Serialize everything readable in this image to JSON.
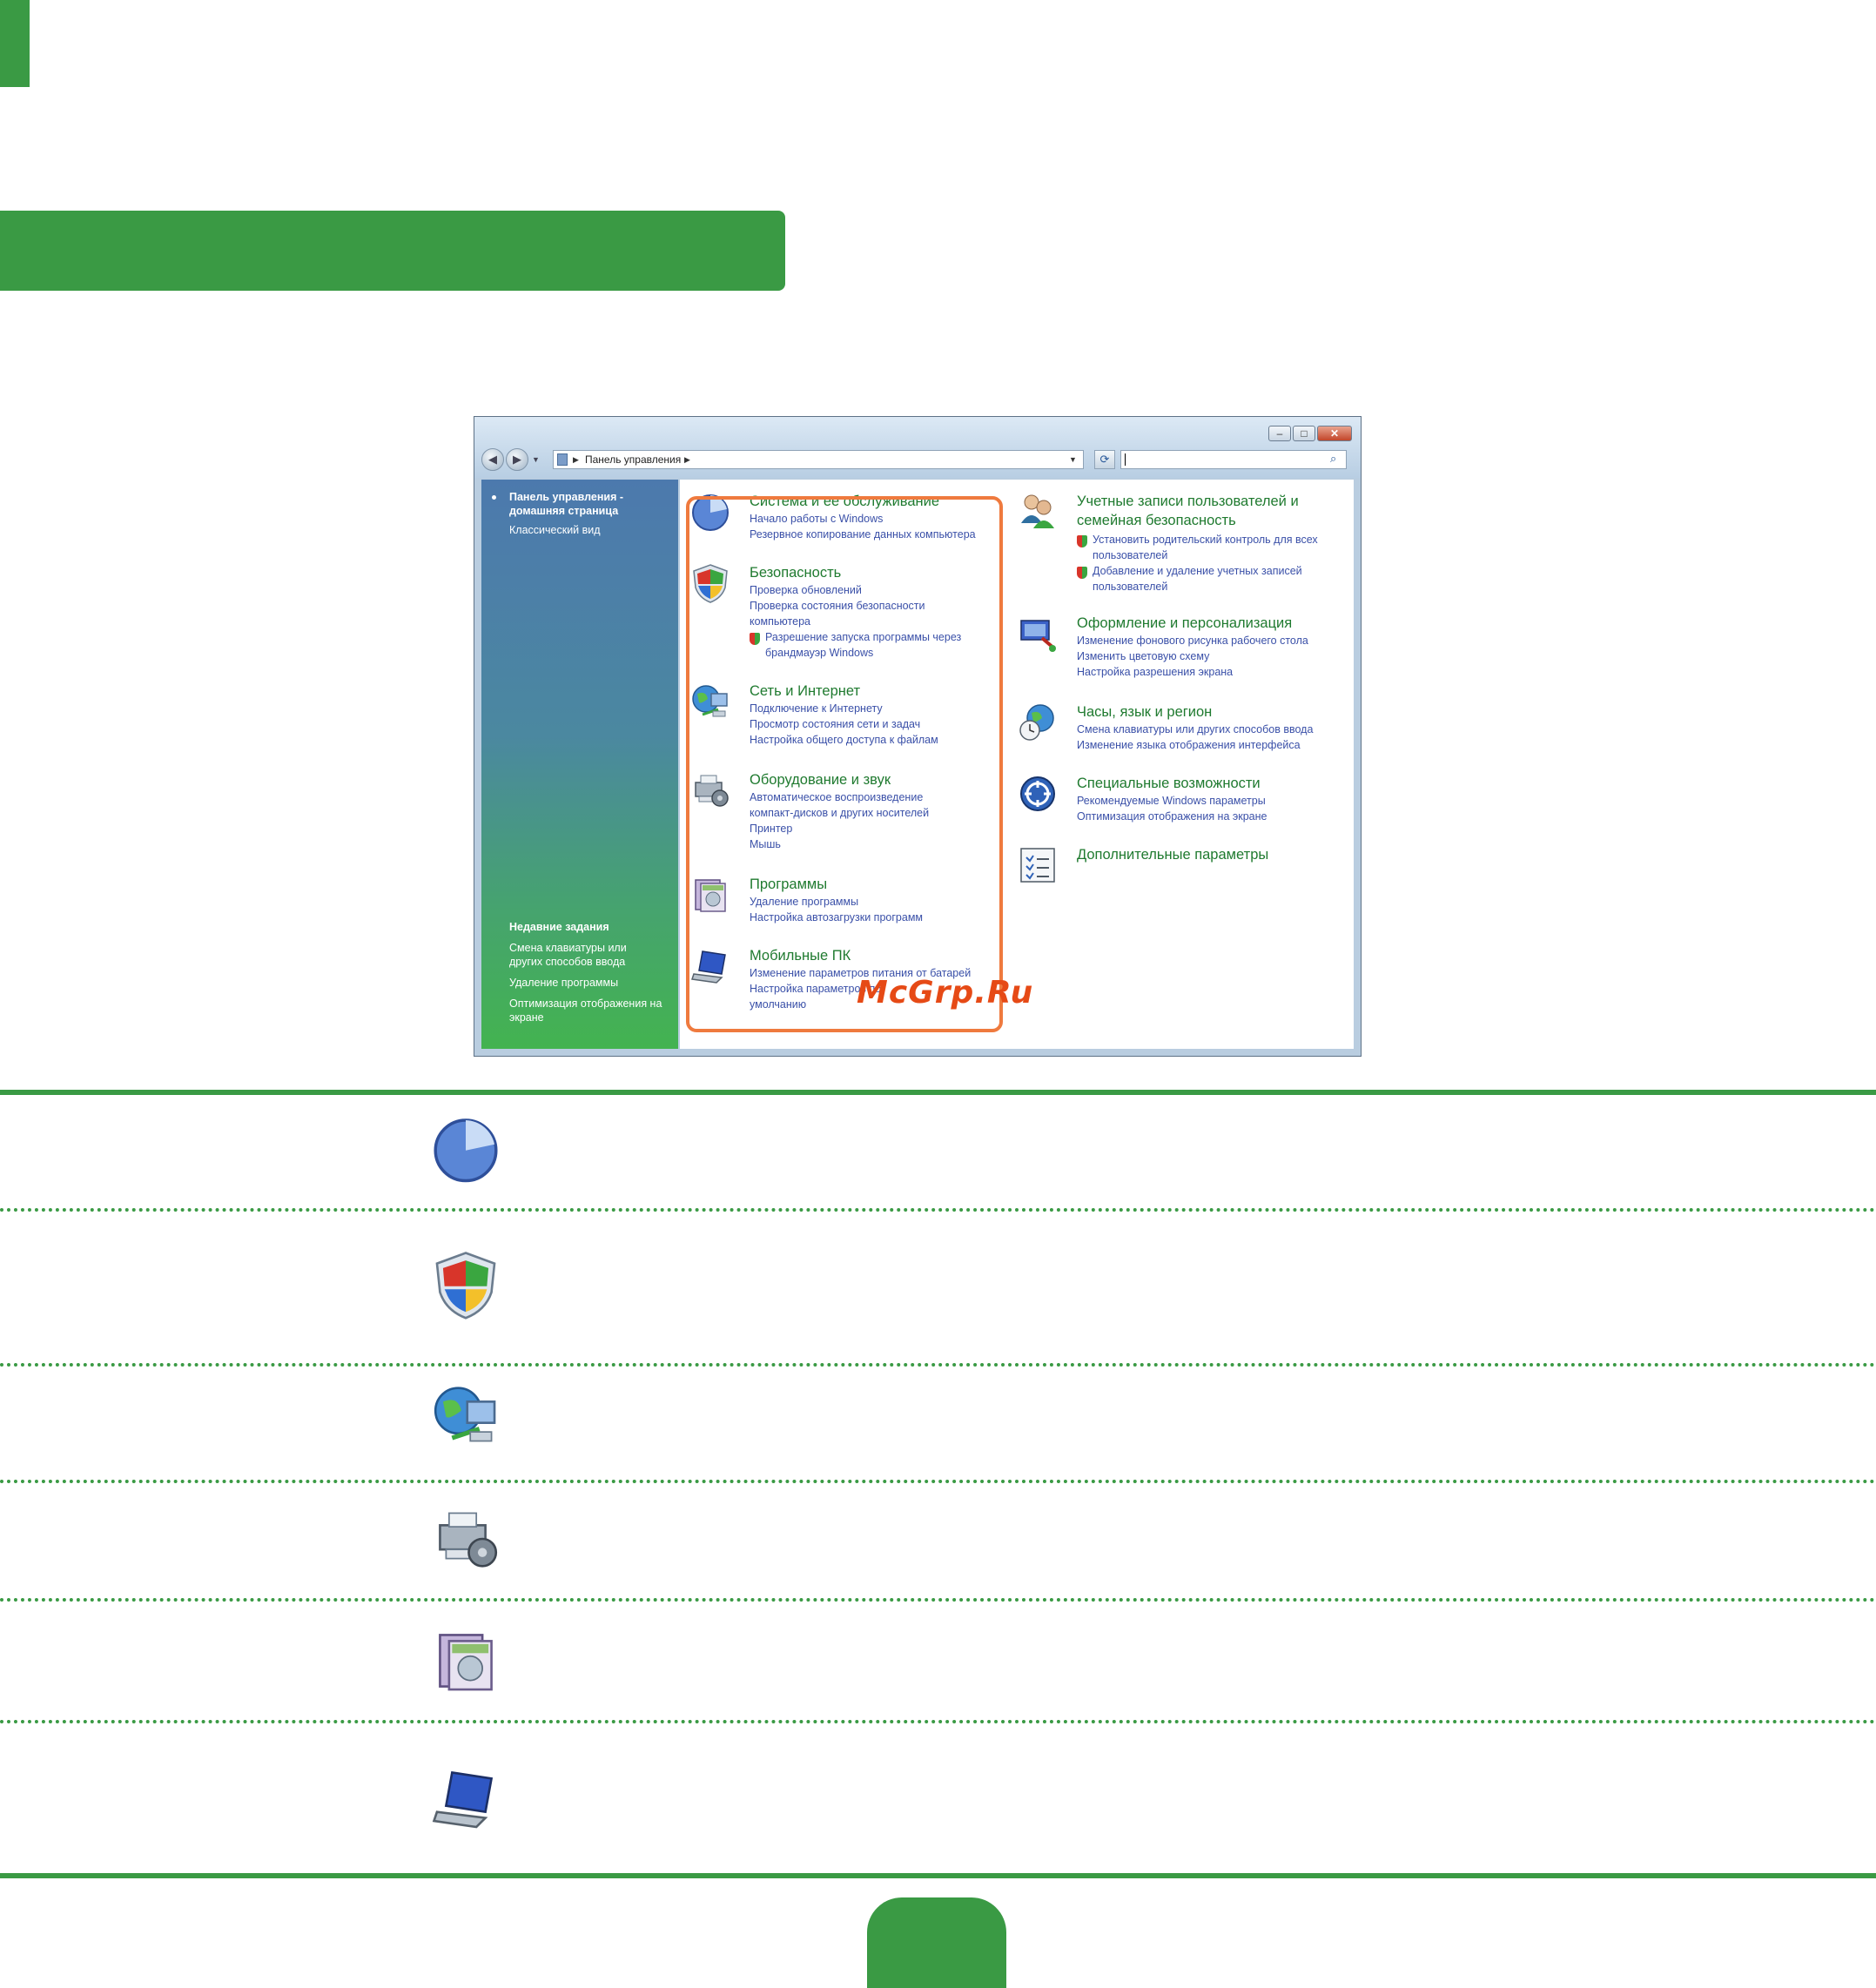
{
  "window": {
    "address": {
      "path_label": "Панель управления"
    },
    "sidebar": {
      "home_link": "Панель управления - домашняя страница",
      "classic_view": "Классический вид",
      "recent_title": "Недавние задания",
      "recent_items": [
        "Смена клавиатуры или других способов ввода",
        "Удаление программы",
        "Оптимизация отображения на экране"
      ]
    },
    "left_categories": [
      {
        "title": "Система и ее обслуживание",
        "icon": "system-maintenance-icon",
        "links": [
          "Начало работы с Windows",
          "Резервное копирование данных компьютера"
        ]
      },
      {
        "title": "Безопасность",
        "icon": "security-shield-icon",
        "links": [
          "Проверка обновлений",
          "Проверка состояния безопасности компьютера",
          "Разрешение запуска программы через брандмауэр Windows"
        ]
      },
      {
        "title": "Сеть и Интернет",
        "icon": "network-internet-icon",
        "links": [
          "Подключение к Интернету",
          "Просмотр состояния сети и задач",
          "Настройка общего доступа к файлам"
        ]
      },
      {
        "title": "Оборудование и звук",
        "icon": "hardware-sound-icon",
        "links": [
          "Автоматическое воспроизведение компакт-дисков и других носителей",
          "Принтер",
          "Мышь"
        ]
      },
      {
        "title": "Программы",
        "icon": "programs-icon",
        "links": [
          "Удаление программы",
          "Настройка автозагрузки программ"
        ]
      },
      {
        "title": "Мобильные ПК",
        "icon": "mobile-pc-icon",
        "links": [
          "Изменение параметров питания от батарей",
          "Настройка параметров по умолчанию"
        ]
      }
    ],
    "right_categories": [
      {
        "title": "Учетные записи пользователей и семейная безопасность",
        "icon": "user-accounts-icon",
        "links": [
          "Установить родительский контроль для всех пользователей",
          "Добавление и удаление учетных записей пользователей"
        ]
      },
      {
        "title": "Оформление и персонализация",
        "icon": "appearance-icon",
        "links": [
          "Изменение фонового рисунка рабочего стола",
          "Изменить цветовую схему",
          "Настройка разрешения экрана"
        ]
      },
      {
        "title": "Часы, язык и регион",
        "icon": "clock-language-region-icon",
        "links": [
          "Смена клавиатуры или других способов ввода",
          "Изменение языка отображения интерфейса"
        ]
      },
      {
        "title": "Специальные возможности",
        "icon": "ease-of-access-icon",
        "links": [
          "Рекомендуемые Windows параметры",
          "Оптимизация отображения на экране"
        ]
      },
      {
        "title": "Дополнительные параметры",
        "icon": "additional-options-icon",
        "links": []
      }
    ],
    "watermark": "McGrp.Ru"
  },
  "table_rows": [
    {
      "icon": "system-maintenance-icon"
    },
    {
      "icon": "security-shield-icon"
    },
    {
      "icon": "network-internet-icon"
    },
    {
      "icon": "hardware-sound-icon"
    },
    {
      "icon": "programs-icon"
    },
    {
      "icon": "mobile-pc-icon"
    }
  ],
  "colors": {
    "brand_green": "#3a9a44",
    "highlight_orange": "#ef7a3e",
    "link_blue": "#3a50a8",
    "title_green": "#1f7a2f"
  }
}
